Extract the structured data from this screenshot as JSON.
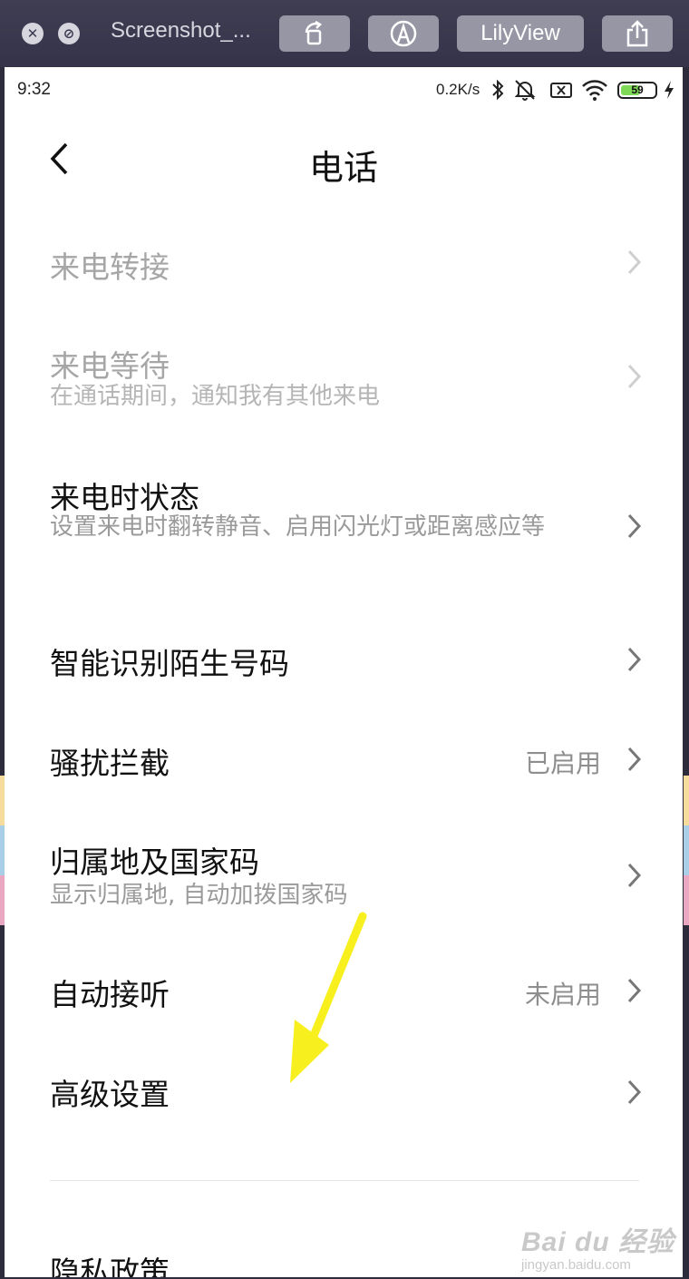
{
  "viewer": {
    "title": "Screenshot_...",
    "lilyview_label": "LilyView"
  },
  "status_bar": {
    "time": "9:32",
    "network_speed": "0.2K/s",
    "battery_level": "59",
    "battery_color": "#7ed957"
  },
  "header": {
    "title": "电话"
  },
  "items": [
    {
      "label": "来电转接",
      "desc": "",
      "value": "",
      "enabled": false
    },
    {
      "label": "来电等待",
      "desc": "在通话期间，通知我有其他来电",
      "value": "",
      "enabled": false
    },
    {
      "label": "来电时状态",
      "desc": "设置来电时翻转静音、启用闪光灯或距离感应等",
      "value": "",
      "enabled": true
    },
    {
      "label": "智能识别陌生号码",
      "desc": "",
      "value": "",
      "enabled": true
    },
    {
      "label": "骚扰拦截",
      "desc": "",
      "value": "已启用",
      "enabled": true
    },
    {
      "label": "归属地及国家码",
      "desc": "显示归属地, 自动加拨国家码",
      "value": "",
      "enabled": true
    },
    {
      "label": "自动接听",
      "desc": "",
      "value": "未启用",
      "enabled": true
    },
    {
      "label": "高级设置",
      "desc": "",
      "value": "",
      "enabled": true
    },
    {
      "label": "隐私政策",
      "desc": "",
      "value": "",
      "enabled": true
    }
  ],
  "annotation": {
    "arrow_color": "#f7f01e"
  },
  "watermark": {
    "main": "Bai du 经验",
    "sub": "jingyan.baidu.com"
  }
}
